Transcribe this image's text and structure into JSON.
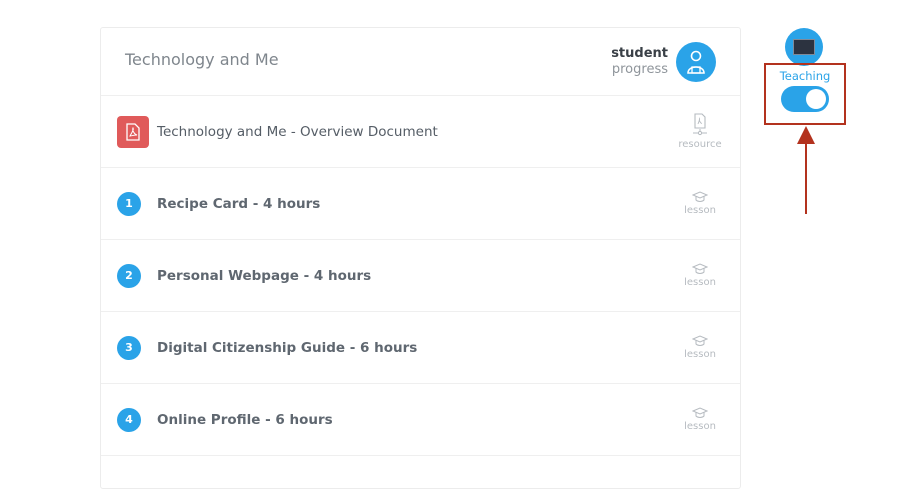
{
  "course": {
    "title": "Technology and Me",
    "progress_strong": "student",
    "progress_sub": "progress"
  },
  "items": [
    {
      "type": "resource",
      "title": "Technology and Me - Overview Document",
      "label": "resource"
    },
    {
      "type": "lesson",
      "number": "1",
      "title": "Recipe Card - 4 hours",
      "label": "lesson"
    },
    {
      "type": "lesson",
      "number": "2",
      "title": "Personal Webpage - 4 hours",
      "label": "lesson"
    },
    {
      "type": "lesson",
      "number": "3",
      "title": "Digital Citizenship Guide - 6 hours",
      "label": "lesson"
    },
    {
      "type": "lesson",
      "number": "4",
      "title": "Online Profile - 6 hours",
      "label": "lesson"
    }
  ],
  "teaching": {
    "label": "Teaching",
    "enabled": true
  },
  "colors": {
    "accent": "#2aa3e8",
    "pdf": "#e05a5a",
    "annotation": "#b3321e"
  }
}
